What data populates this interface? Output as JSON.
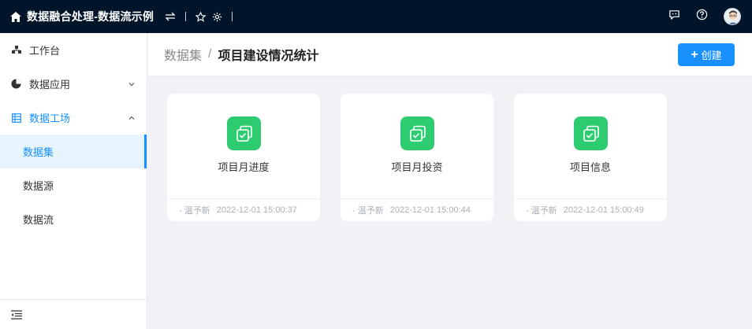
{
  "app": {
    "title": "数据融合处理-数据流示例",
    "icons": [
      "home-icon",
      "swap-icon",
      "star-icon",
      "gear-icon",
      "chat-icon",
      "help-icon",
      "avatar"
    ]
  },
  "sidebar": {
    "items": [
      {
        "label": "工作台",
        "icon": "workbench-icon"
      },
      {
        "label": "数据应用",
        "icon": "pie-chart-icon",
        "expanded": false
      },
      {
        "label": "数据工场",
        "icon": "list-icon",
        "expanded": true
      }
    ],
    "subitems": [
      {
        "label": "数据集",
        "active": true
      },
      {
        "label": "数据源",
        "active": false
      },
      {
        "label": "数据流",
        "active": false
      }
    ]
  },
  "breadcrumb": {
    "parent": "数据集",
    "separator": "/",
    "current": "项目建设情况统计"
  },
  "toolbar": {
    "create_label": "创建",
    "accent": "#1890ff"
  },
  "cards": [
    {
      "name": "项目月进度",
      "author": "- 温予新",
      "time": "2022-12-01 15:00:37"
    },
    {
      "name": "项目月投资",
      "author": "- 温予新",
      "time": "2022-12-01 15:00:44"
    },
    {
      "name": "项目信息",
      "author": "- 温予新",
      "time": "2022-12-01 15:00:49"
    }
  ],
  "colors": {
    "topbar": "#001529",
    "card_icon": "#2ecc71",
    "active_bg": "#e6f4ff"
  }
}
